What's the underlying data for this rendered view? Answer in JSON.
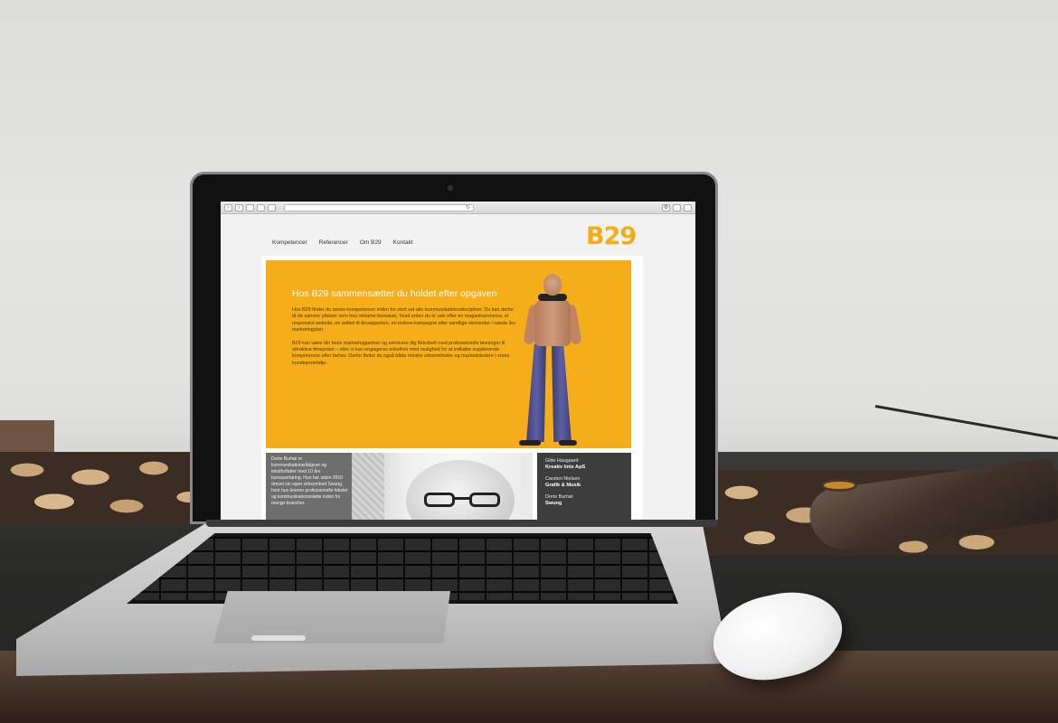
{
  "browser": {
    "toolbar_icons": [
      "back-icon",
      "forward-icon",
      "sidebar-icon",
      "cloud-icon",
      "reader-icon",
      "reload-icon",
      "settings-icon",
      "share-icon",
      "tabs-icon"
    ]
  },
  "site": {
    "logo": "B29",
    "nav": [
      {
        "label": "Kompetencer"
      },
      {
        "label": "Referencer"
      },
      {
        "label": "Om B29"
      },
      {
        "label": "Kontakt"
      }
    ],
    "hero": {
      "title": "Hos B29 sammensætter du holdet efter opgaven",
      "paragraph1": "Hos B29 finder du senior-kompetencer inden for stort set alle kommunikationsdiscipliner. Du kan derfor få de samme ydelser som hos reklame-bureauer, hvad enten du er ude efter en magasinannonce, et responsivt website, en artikel til årsrapporten, en instore-kampagne eller samtlige elementer i næste års marketingplan.",
      "paragraph2": "B29 kan være din faste marketingpartner og servicere dig fleksibelt med professionelle løsninger til attraktive timepriser – eller vi kan engageres enkeltvis med mulighed for at indkøbe supplerende kompetencer efter behov. Derfor finder du også både mindre virksomheder og markedsledere i vores kundeportefølje."
    },
    "bio": {
      "text": "Dorte Burhøi er kommunikationsrådgiver og tekstforfatter med 10 års bureauerfaring. Hun har siden 2010 drevet sin egen virksomhed Swung, hvor hun leverer professionelle tekster og kommunikationsstøtte inden for mange brancher."
    },
    "people": [
      {
        "name": "Gitte Haugaard",
        "company": "Kreativ linie ApS"
      },
      {
        "name": "Carsten Nielsen",
        "company": "Grafik & Musik"
      },
      {
        "name": "Dorte Burhøi",
        "company": "Swung"
      }
    ]
  },
  "colors": {
    "brand_yellow": "#f5ad1a",
    "dark_panel": "#3d3d3d",
    "bio_panel": "#6e6e6e"
  }
}
